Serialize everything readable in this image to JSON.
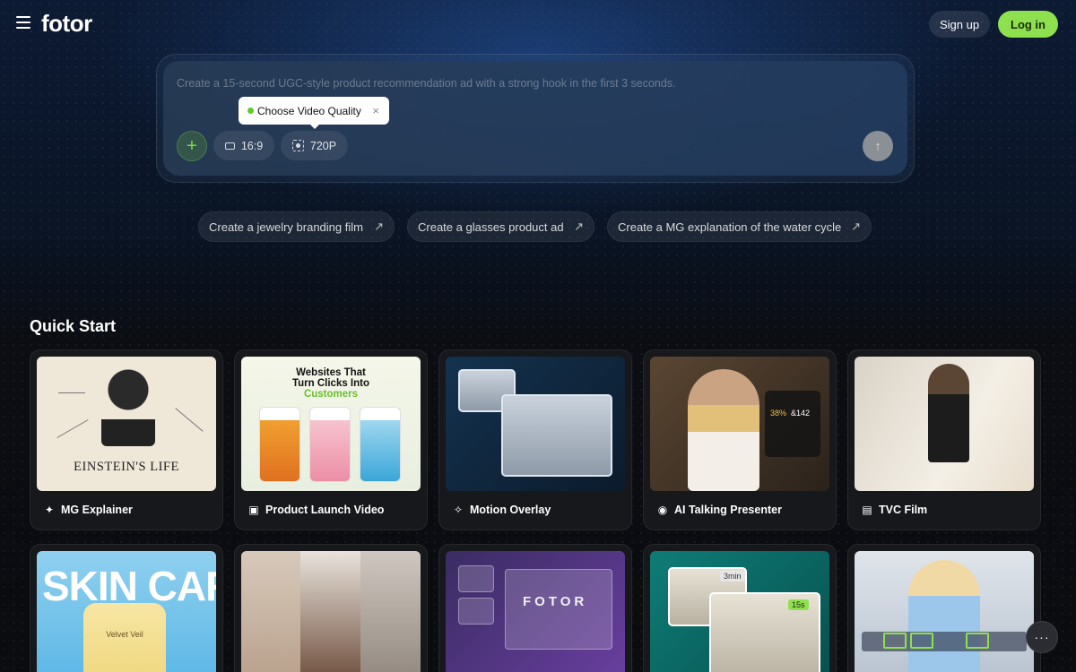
{
  "header": {
    "logo": "fotor",
    "signup_label": "Sign up",
    "login_label": "Log in"
  },
  "prompt": {
    "placeholder": "Create a 15-second UGC-style product recommendation ad with a strong hook in the first 3 seconds.",
    "tooltip": "Choose Video Quality",
    "tooltip_close": "×",
    "add_label": "+",
    "aspect_ratio": "16:9",
    "quality": "720P",
    "send_label": "↑"
  },
  "suggestions": [
    {
      "label": "Create a jewelry branding film",
      "arrow": "↗"
    },
    {
      "label": "Create a glasses product ad",
      "arrow": "↗"
    },
    {
      "label": "Create a MG explanation of the water cycle",
      "arrow": "↗"
    }
  ],
  "quick_start": {
    "title": "Quick Start",
    "cards": [
      {
        "label": "MG Explainer",
        "icon": "sparkle-icon",
        "thumb_caption": "EINSTEIN'S LIFE"
      },
      {
        "label": "Product Launch Video",
        "icon": "product-video-icon",
        "thumb_heading_1": "Websites That",
        "thumb_heading_2": "Turn Clicks Into",
        "thumb_heading_3": "Customers"
      },
      {
        "label": "Motion Overlay",
        "icon": "magic-wand-icon"
      },
      {
        "label": "AI Talking Presenter",
        "icon": "talking-head-icon",
        "stat_1": "38%",
        "stat_2": "&142"
      },
      {
        "label": "TVC Film",
        "icon": "tv-icon"
      },
      {
        "thumb_caption": "SKIN CARE",
        "thumb_sub": "Velvet Veil"
      },
      {},
      {
        "thumb_caption": "FOTOR"
      },
      {
        "tag_1": "3min",
        "tag_2": "15s"
      },
      {}
    ]
  },
  "fab_label": "···",
  "colors": {
    "accent_green": "#8ee04f",
    "page_bg": "#0b0c10"
  }
}
